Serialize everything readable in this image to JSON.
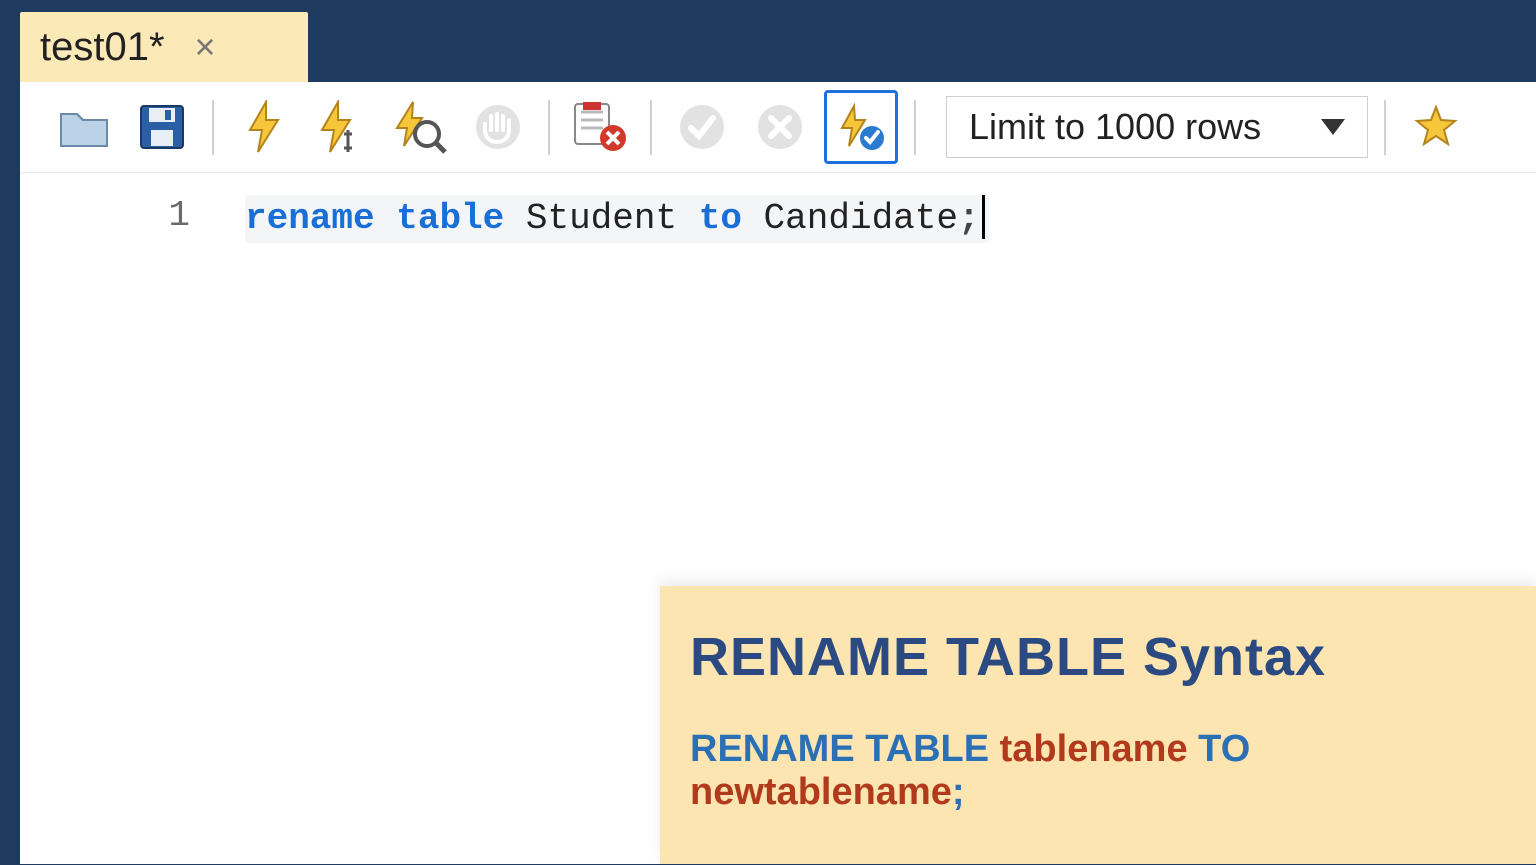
{
  "tab": {
    "title": "test01*",
    "close_glyph": "×"
  },
  "toolbar": {
    "limit_label": "Limit to 1000 rows"
  },
  "editor": {
    "line_number": "1",
    "sql": {
      "kw1": "rename",
      "kw2": "table",
      "tbl": "Student",
      "kw3": "to",
      "newname": "Candidate",
      "term": ";"
    }
  },
  "help": {
    "title": "RENAME  TABLE Syntax",
    "kw_rename": "RENAME ",
    "kw_table": " TABLE ",
    "p_old": "tablename",
    "kw_to": " TO ",
    "p_new": "newtablename",
    "term": ";"
  }
}
